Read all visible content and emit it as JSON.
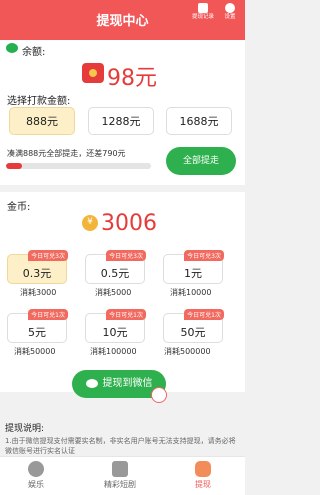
{
  "header": {
    "title": "提现中心",
    "record_label": "提现记录",
    "settings_label": "设置"
  },
  "balance": {
    "label": "余额:",
    "amount": "98元",
    "choose_label": "选择打款金额:",
    "options": [
      "888元",
      "1288元",
      "1688元"
    ],
    "selected_index": 0,
    "progress_note": "凑满888元全部提走，还差790元",
    "progress_fraction": 0.11,
    "withdraw_all_label": "全部提走"
  },
  "coins": {
    "label": "金币:",
    "amount": "3006",
    "options": [
      {
        "badge": "今日可兑3次",
        "value": "0.3元",
        "consume": "消耗3000"
      },
      {
        "badge": "今日可兑3次",
        "value": "0.5元",
        "consume": "消耗5000"
      },
      {
        "badge": "今日可兑3次",
        "value": "1元",
        "consume": "消耗10000"
      },
      {
        "badge": "今日可兑1次",
        "value": "5元",
        "consume": "消耗50000"
      },
      {
        "badge": "今日可兑1次",
        "value": "10元",
        "consume": "消耗100000"
      },
      {
        "badge": "今日可兑1次",
        "value": "50元",
        "consume": "消耗500000"
      }
    ],
    "selected_index": 0,
    "withdraw_wechat_label": "提现到微信"
  },
  "explanation": {
    "title": "提现说明:",
    "text": "1.由于微信提现支付需要实名制，非实名用户账号无法支持提现，请务必将微信账号进行实名认证"
  },
  "nav": {
    "items": [
      "娱乐",
      "精彩短剧",
      "提现"
    ],
    "active_index": 2
  },
  "colors": {
    "brand_red": "#f25757",
    "amount_red": "#e63b3b",
    "green": "#2fb04f",
    "selected_bg": "#fdf0c9"
  }
}
